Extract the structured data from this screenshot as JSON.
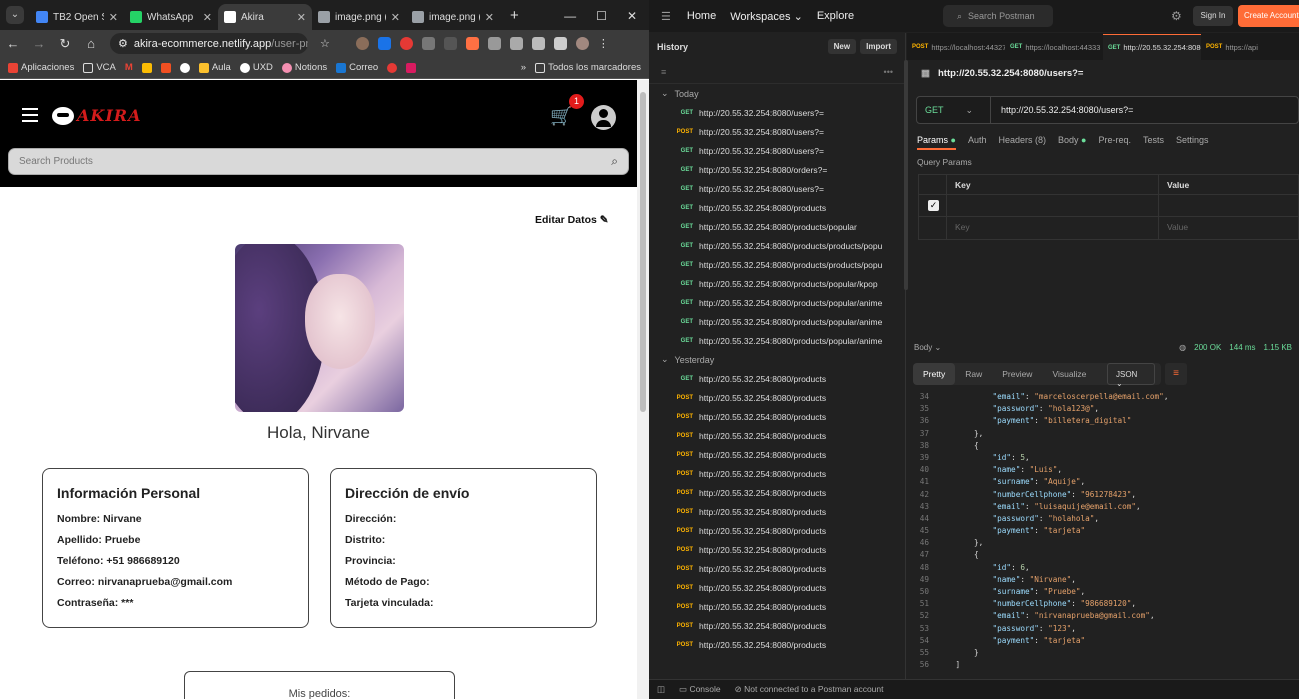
{
  "browser": {
    "tabs": [
      {
        "title": "TB2 Open S",
        "icon_color": "#4285f4"
      },
      {
        "title": "WhatsApp",
        "icon_color": "#25d366"
      },
      {
        "title": "Akira",
        "icon_color": "#ffffff"
      },
      {
        "title": "image.png (",
        "icon_color": "#9aa0a6"
      },
      {
        "title": "image.png (",
        "icon_color": "#9aa0a6"
      }
    ],
    "new_tab": "+",
    "url_host": "akira-ecommerce.netlify.app",
    "url_path": "/user-profile",
    "bookmarks": [
      "Aplicaciones",
      "VCA",
      "M",
      "",
      "",
      "",
      "Aula",
      "UXD",
      "Notions",
      "Correo",
      "",
      ""
    ],
    "bookmarks_folder": "Todos los marcadores"
  },
  "akira": {
    "logo": "AKIRA",
    "cart_count": "1",
    "search_placeholder": "Search Products",
    "edit_label": "Editar Datos",
    "greeting": "Hola, Nirvane",
    "personal": {
      "title": "Información Personal",
      "rows": [
        "Nombre: Nirvane",
        "Apellido: Pruebe",
        "Teléfono: +51 986689120",
        "Correo: nirvanaprueba@gmail.com",
        "Contraseña: ***"
      ]
    },
    "shipping": {
      "title": "Dirección de envío",
      "rows": [
        "Dirección:",
        "Distrito:",
        "Provincia:",
        "Método de Pago:",
        "Tarjeta vinculada:"
      ]
    },
    "orders_title": "Mis pedidos:"
  },
  "postman": {
    "nav": [
      "Home",
      "Workspaces",
      "Explore"
    ],
    "search": "Search Postman",
    "signin": "Sign In",
    "create": "Create Account",
    "history_title": "History",
    "new_btn": "New",
    "import_btn": "Import",
    "group_today": "Today",
    "group_yesterday": "Yesterday",
    "today": [
      {
        "m": "GET",
        "u": "http://20.55.32.254:8080/users?="
      },
      {
        "m": "POST",
        "u": "http://20.55.32.254:8080/users?="
      },
      {
        "m": "GET",
        "u": "http://20.55.32.254:8080/users?="
      },
      {
        "m": "GET",
        "u": "http://20.55.32.254:8080/orders?="
      },
      {
        "m": "GET",
        "u": "http://20.55.32.254:8080/users?="
      },
      {
        "m": "GET",
        "u": "http://20.55.32.254:8080/products"
      },
      {
        "m": "GET",
        "u": "http://20.55.32.254:8080/products/popular"
      },
      {
        "m": "GET",
        "u": "http://20.55.32.254:8080/products/products/popu"
      },
      {
        "m": "GET",
        "u": "http://20.55.32.254:8080/products/products/popu"
      },
      {
        "m": "GET",
        "u": "http://20.55.32.254:8080/products/popular/kpop"
      },
      {
        "m": "GET",
        "u": "http://20.55.32.254:8080/products/popular/anime"
      },
      {
        "m": "GET",
        "u": "http://20.55.32.254:8080/products/popular/anime"
      },
      {
        "m": "GET",
        "u": "http://20.55.32.254:8080/products/popular/anime"
      }
    ],
    "yesterday": [
      {
        "m": "GET",
        "u": "http://20.55.32.254:8080/products"
      },
      {
        "m": "POST",
        "u": "http://20.55.32.254:8080/products"
      },
      {
        "m": "POST",
        "u": "http://20.55.32.254:8080/products"
      },
      {
        "m": "POST",
        "u": "http://20.55.32.254:8080/products"
      },
      {
        "m": "POST",
        "u": "http://20.55.32.254:8080/products"
      },
      {
        "m": "POST",
        "u": "http://20.55.32.254:8080/products"
      },
      {
        "m": "POST",
        "u": "http://20.55.32.254:8080/products"
      },
      {
        "m": "POST",
        "u": "http://20.55.32.254:8080/products"
      },
      {
        "m": "POST",
        "u": "http://20.55.32.254:8080/products"
      },
      {
        "m": "POST",
        "u": "http://20.55.32.254:8080/products"
      },
      {
        "m": "POST",
        "u": "http://20.55.32.254:8080/products"
      },
      {
        "m": "POST",
        "u": "http://20.55.32.254:8080/products"
      },
      {
        "m": "POST",
        "u": "http://20.55.32.254:8080/products"
      },
      {
        "m": "POST",
        "u": "http://20.55.32.254:8080/products"
      },
      {
        "m": "POST",
        "u": "http://20.55.32.254:8080/products"
      }
    ],
    "req_tabs": [
      {
        "m": "POST",
        "u": "https://localhost:44327",
        "active": false
      },
      {
        "m": "GET",
        "u": "https://localhost:44333",
        "active": false
      },
      {
        "m": "GET",
        "u": "http://20.55.32.254:8080",
        "active": true
      },
      {
        "m": "POST",
        "u": "https://api",
        "active": false
      }
    ],
    "req_title": "http://20.55.32.254:8080/users?=",
    "method": "GET",
    "req_url": "http://20.55.32.254:8080/users?=",
    "param_tabs": [
      "Params",
      "Auth",
      "Headers (8)",
      "Body",
      "Pre-req.",
      "Tests",
      "Settings"
    ],
    "query_params": "Query Params",
    "col_key": "Key",
    "col_value": "Value",
    "ph_key": "Key",
    "ph_value": "Value",
    "resp_label": "Body",
    "status": "200 OK",
    "time": "144 ms",
    "size": "1.15 KB",
    "view_tabs": [
      "Pretty",
      "Raw",
      "Preview",
      "Visualize"
    ],
    "format": "JSON",
    "code": [
      {
        "n": "34",
        "t": "            \"email\": \"marceloscerpella@email.com\","
      },
      {
        "n": "35",
        "t": "            \"password\": \"hola123@\","
      },
      {
        "n": "36",
        "t": "            \"payment\": \"billetera_digital\""
      },
      {
        "n": "37",
        "t": "        },"
      },
      {
        "n": "38",
        "t": "        {"
      },
      {
        "n": "39",
        "t": "            \"id\": 5,"
      },
      {
        "n": "40",
        "t": "            \"name\": \"Luis\","
      },
      {
        "n": "41",
        "t": "            \"surname\": \"Aquije\","
      },
      {
        "n": "42",
        "t": "            \"numberCellphone\": \"961278423\","
      },
      {
        "n": "43",
        "t": "            \"email\": \"luisaquije@email.com\","
      },
      {
        "n": "44",
        "t": "            \"password\": \"holahola\","
      },
      {
        "n": "45",
        "t": "            \"payment\": \"tarjeta\""
      },
      {
        "n": "46",
        "t": "        },"
      },
      {
        "n": "47",
        "t": "        {"
      },
      {
        "n": "48",
        "t": "            \"id\": 6,"
      },
      {
        "n": "49",
        "t": "            \"name\": \"Nirvane\","
      },
      {
        "n": "50",
        "t": "            \"surname\": \"Pruebe\","
      },
      {
        "n": "51",
        "t": "            \"numberCellphone\": \"986689120\","
      },
      {
        "n": "52",
        "t": "            \"email\": \"nirvanaprueba@gmail.com\","
      },
      {
        "n": "53",
        "t": "            \"password\": \"123\","
      },
      {
        "n": "54",
        "t": "            \"payment\": \"tarjeta\""
      },
      {
        "n": "55",
        "t": "        }"
      },
      {
        "n": "56",
        "t": "    ]"
      }
    ],
    "console": "Console",
    "not_connected": "Not connected to a Postman account"
  }
}
